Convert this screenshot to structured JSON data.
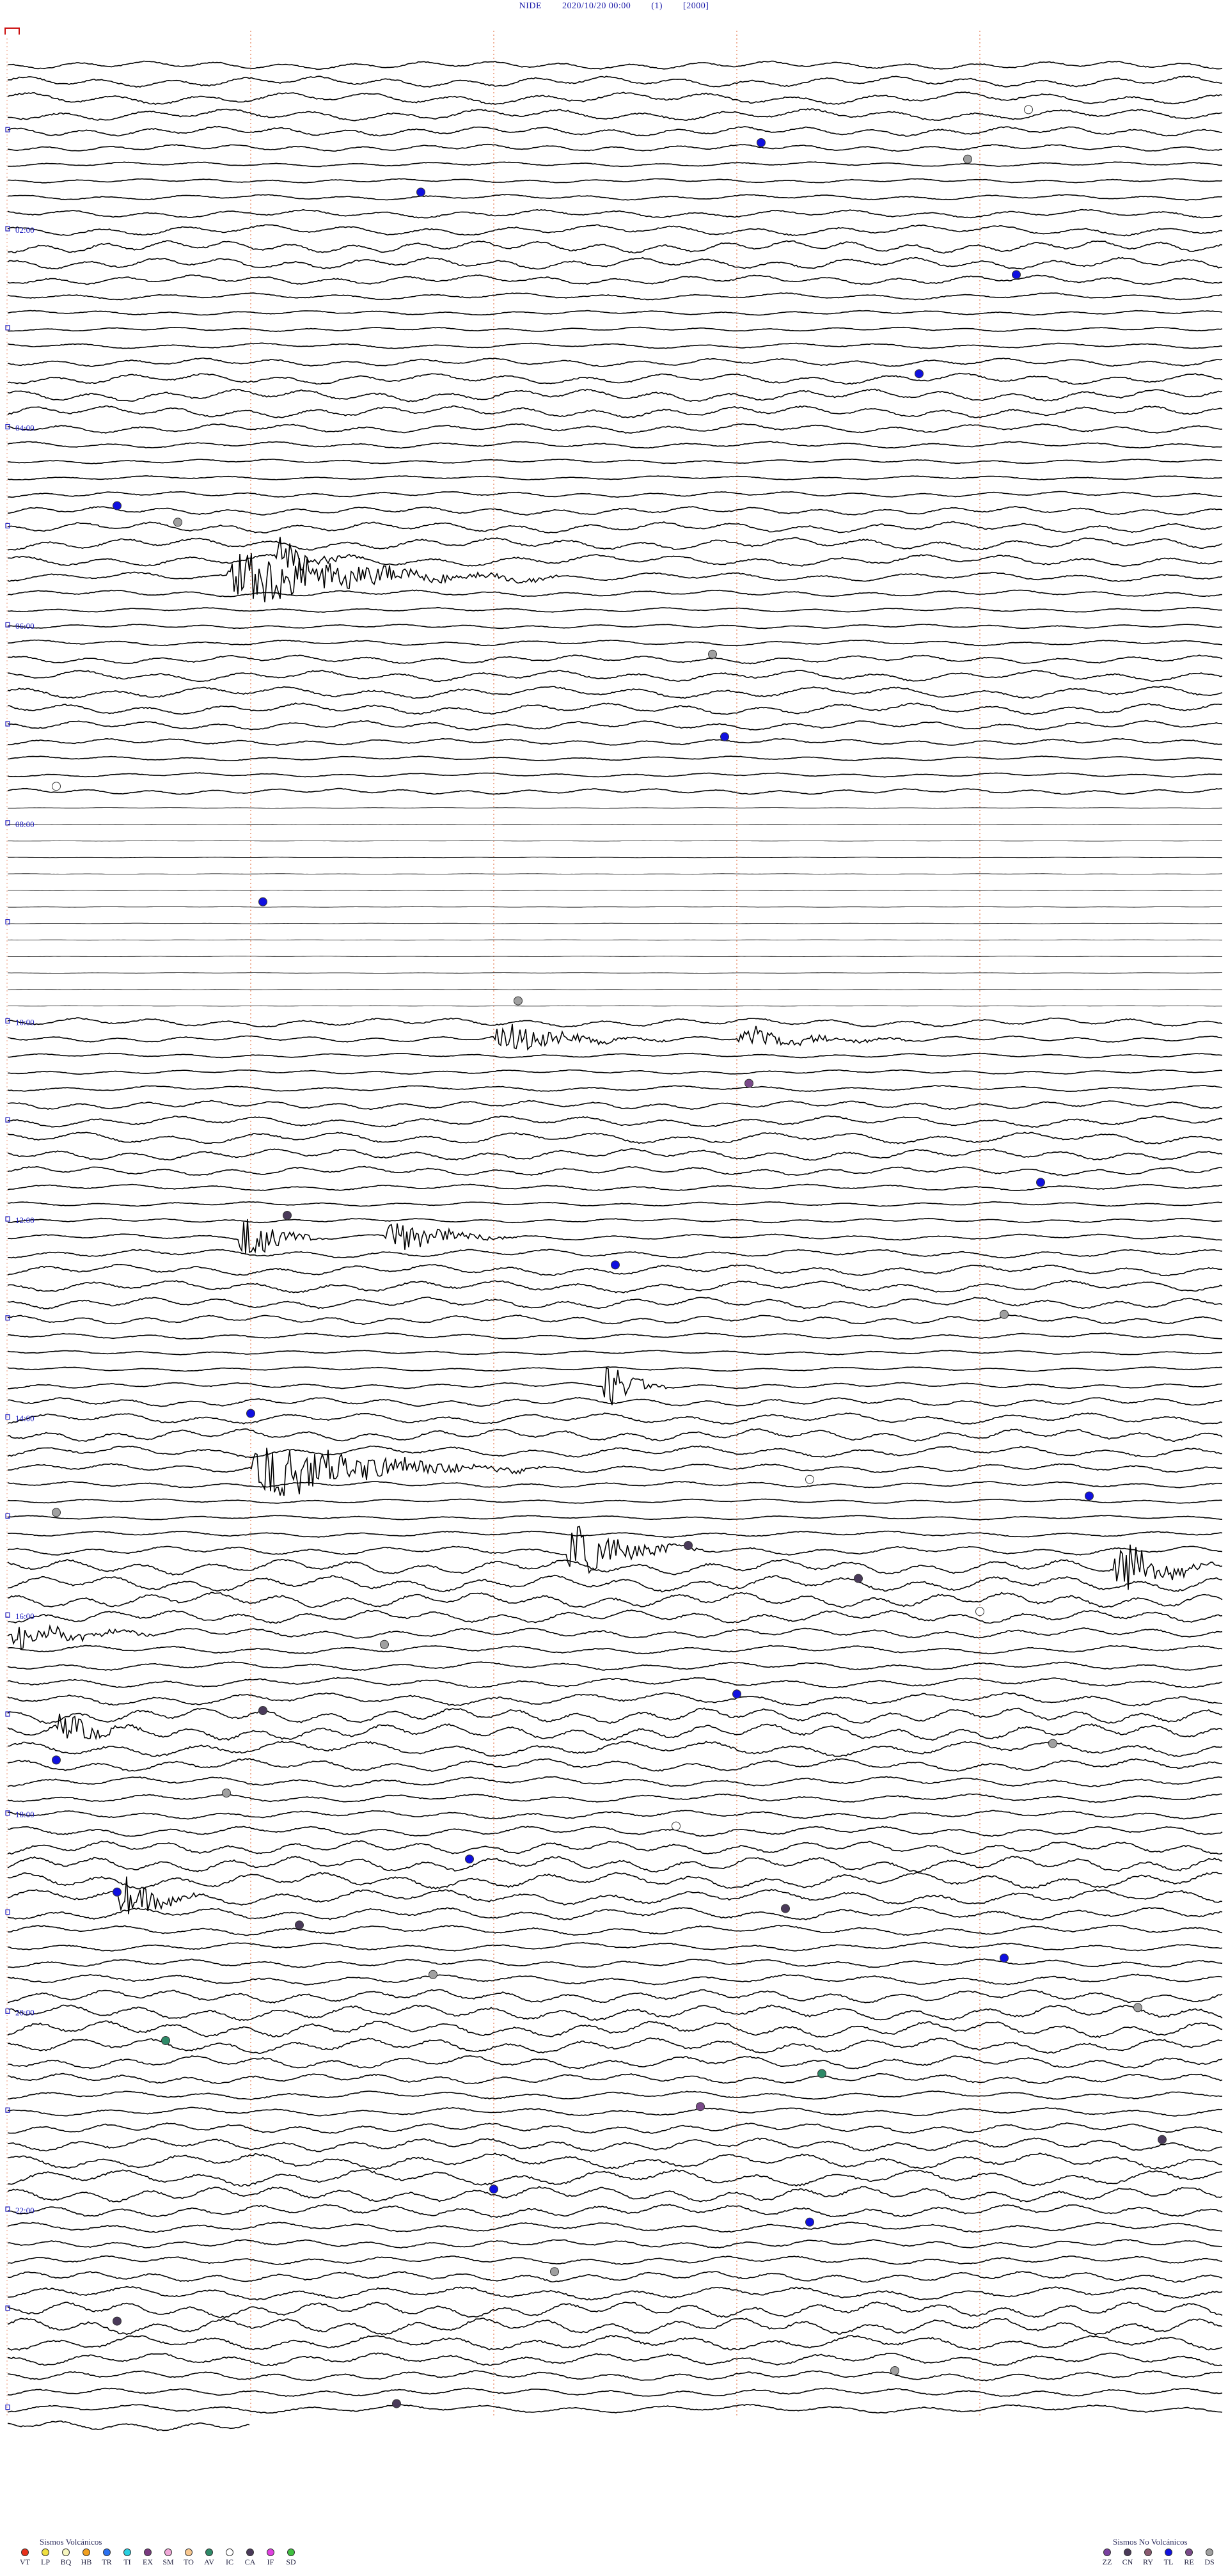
{
  "header": {
    "station": "NIDE",
    "datetime": "2020/10/20 00:00",
    "channel": "(1)",
    "scale": "[2000]"
  },
  "chart_data": {
    "type": "line",
    "row_labels": [
      "02:00",
      "04:00",
      "06:00",
      "08:00",
      "10:00",
      "12:00",
      "14:00",
      "16:00",
      "18:00",
      "20:00",
      "22:00"
    ],
    "rows": 144,
    "minutes_per_row": 10,
    "events": [
      {
        "row": 3,
        "minute": 8.4,
        "type": "IC"
      },
      {
        "row": 5,
        "minute": 6.2,
        "type": "TL"
      },
      {
        "row": 8,
        "minute": 3.4,
        "type": "TL"
      },
      {
        "row": 6,
        "minute": 7.9,
        "type": "DS"
      },
      {
        "row": 13,
        "minute": 8.3,
        "type": "TL"
      },
      {
        "row": 19,
        "minute": 7.5,
        "type": "TL"
      },
      {
        "row": 27,
        "minute": 0.9,
        "type": "TL"
      },
      {
        "row": 28,
        "minute": 1.4,
        "type": "DS"
      },
      {
        "row": 36,
        "minute": 5.8,
        "type": "DS"
      },
      {
        "row": 41,
        "minute": 5.9,
        "type": "TL"
      },
      {
        "row": 44,
        "minute": 0.4,
        "type": "IC"
      },
      {
        "row": 51,
        "minute": 2.1,
        "type": "TL"
      },
      {
        "row": 57,
        "minute": 4.2,
        "type": "DS"
      },
      {
        "row": 62,
        "minute": 6.1,
        "type": "RE"
      },
      {
        "row": 68,
        "minute": 8.5,
        "type": "TL"
      },
      {
        "row": 70,
        "minute": 2.3,
        "type": "CA"
      },
      {
        "row": 73,
        "minute": 5.0,
        "type": "TL"
      },
      {
        "row": 76,
        "minute": 8.2,
        "type": "DS"
      },
      {
        "row": 82,
        "minute": 2.0,
        "type": "TL"
      },
      {
        "row": 86,
        "minute": 6.6,
        "type": "IC"
      },
      {
        "row": 87,
        "minute": 8.9,
        "type": "TL"
      },
      {
        "row": 88,
        "minute": 0.4,
        "type": "DS"
      },
      {
        "row": 90,
        "minute": 5.6,
        "type": "CA"
      },
      {
        "row": 92,
        "minute": 7.0,
        "type": "CA"
      },
      {
        "row": 94,
        "minute": 8.0,
        "type": "IC"
      },
      {
        "row": 96,
        "minute": 3.1,
        "type": "DS"
      },
      {
        "row": 99,
        "minute": 6.0,
        "type": "TL"
      },
      {
        "row": 100,
        "minute": 2.1,
        "type": "CA"
      },
      {
        "row": 102,
        "minute": 8.6,
        "type": "DS"
      },
      {
        "row": 103,
        "minute": 0.4,
        "type": "TL"
      },
      {
        "row": 105,
        "minute": 1.8,
        "type": "DS"
      },
      {
        "row": 107,
        "minute": 5.5,
        "type": "IC"
      },
      {
        "row": 109,
        "minute": 3.8,
        "type": "TL"
      },
      {
        "row": 111,
        "minute": 0.9,
        "type": "TL"
      },
      {
        "row": 112,
        "minute": 6.4,
        "type": "CA"
      },
      {
        "row": 113,
        "minute": 2.4,
        "type": "CA"
      },
      {
        "row": 115,
        "minute": 8.2,
        "type": "TL"
      },
      {
        "row": 116,
        "minute": 3.5,
        "type": "DS"
      },
      {
        "row": 118,
        "minute": 9.3,
        "type": "DS"
      },
      {
        "row": 120,
        "minute": 1.3,
        "type": "AV"
      },
      {
        "row": 122,
        "minute": 6.7,
        "type": "AV"
      },
      {
        "row": 124,
        "minute": 5.7,
        "type": "RE"
      },
      {
        "row": 126,
        "minute": 9.5,
        "type": "CA"
      },
      {
        "row": 129,
        "minute": 4.0,
        "type": "TL"
      },
      {
        "row": 131,
        "minute": 6.6,
        "type": "TL"
      },
      {
        "row": 134,
        "minute": 4.5,
        "type": "DS"
      },
      {
        "row": 137,
        "minute": 0.9,
        "type": "CA"
      },
      {
        "row": 140,
        "minute": 7.3,
        "type": "DS"
      },
      {
        "row": 142,
        "minute": 3.2,
        "type": "CA"
      }
    ],
    "bursts": [
      {
        "row": 31,
        "start": 1.8,
        "end": 4.1,
        "amp": 1.0
      },
      {
        "row": 30,
        "start": 2.2,
        "end": 2.5,
        "amp": 0.7
      },
      {
        "row": 80,
        "start": 4.9,
        "end": 5.0,
        "amp": 0.9
      },
      {
        "row": 71,
        "start": 1.9,
        "end": 2.2,
        "amp": 0.9
      },
      {
        "row": 71,
        "start": 3.1,
        "end": 3.8,
        "amp": 0.6
      },
      {
        "row": 85,
        "start": 2.0,
        "end": 4.0,
        "amp": 1.0
      },
      {
        "row": 90,
        "start": 4.6,
        "end": 5.3,
        "amp": 1.0
      },
      {
        "row": 91,
        "start": 9.1,
        "end": 9.5,
        "amp": 1.0
      },
      {
        "row": 95,
        "start": 0.0,
        "end": 0.8,
        "amp": 0.5
      },
      {
        "row": 101,
        "start": 0.4,
        "end": 0.8,
        "amp": 0.5
      },
      {
        "row": 111,
        "start": 0.9,
        "end": 1.2,
        "amp": 0.8
      },
      {
        "row": 59,
        "start": 4.0,
        "end": 5.0,
        "amp": 0.5
      },
      {
        "row": 59,
        "start": 6.0,
        "end": 7.0,
        "amp": 0.4
      }
    ],
    "quiet_rows": [
      45,
      46,
      47,
      48,
      49,
      50,
      51,
      52,
      53,
      54,
      55,
      56,
      57
    ]
  },
  "legend": {
    "volcanic_title": "Sismos Volcánicos",
    "volcanic": [
      {
        "code": "VT",
        "color": "#e8301c"
      },
      {
        "code": "LP",
        "color": "#f0e040"
      },
      {
        "code": "BQ",
        "color": "#f7f7c0"
      },
      {
        "code": "HB",
        "color": "#f2a020"
      },
      {
        "code": "TR",
        "color": "#2a70f0"
      },
      {
        "code": "TI",
        "color": "#28d0e0"
      },
      {
        "code": "EX",
        "color": "#7a3a80"
      },
      {
        "code": "SM",
        "color": "#f0a8d8"
      },
      {
        "code": "TO",
        "color": "#f8c890"
      },
      {
        "code": "AV",
        "color": "#2e8a68"
      },
      {
        "code": "IC",
        "color": "#ffffff"
      },
      {
        "code": "CA",
        "color": "#4a3a5a"
      },
      {
        "code": "IF",
        "color": "#e040e0"
      },
      {
        "code": "SD",
        "color": "#40c040"
      }
    ],
    "nonvolcanic_title": "Sismos No Volcánicos",
    "nonvolcanic": [
      {
        "code": "ZZ",
        "color": "#7a40a0"
      },
      {
        "code": "CN",
        "color": "#4a3a5a"
      },
      {
        "code": "RY",
        "color": "#8a5a70"
      },
      {
        "code": "TL",
        "color": "#1010e0"
      },
      {
        "code": "RE",
        "color": "#7a4a8a"
      },
      {
        "code": "DS",
        "color": "#a0a0a0"
      }
    ]
  },
  "colors": {
    "trace": "#000000",
    "minute_marker": "#e0501a",
    "hour_label": "#2020c0",
    "header": "#1a1aa8"
  }
}
